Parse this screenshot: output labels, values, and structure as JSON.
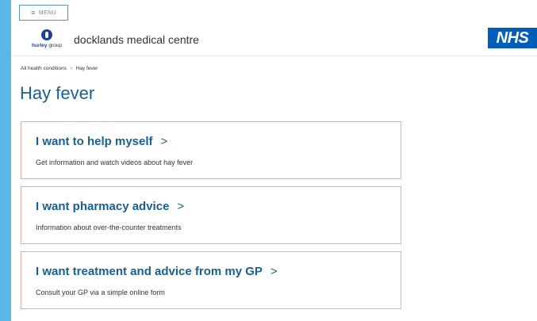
{
  "header": {
    "menu_label": "MENU",
    "logo_text_part1": "hurley",
    "logo_text_part2": "group",
    "practice_name": "docklands medical centre",
    "nhs_logo": "NHS"
  },
  "breadcrumb": {
    "parent": "All health conditions",
    "separator": ">",
    "current": "Hay fever"
  },
  "page_title": "Hay fever",
  "cards": [
    {
      "title": "I want to help myself",
      "chevron": ">",
      "description": "Get information and watch videos about hay fever"
    },
    {
      "title": "I want pharmacy advice",
      "chevron": ">",
      "description": "Information about over-the-counter treatments"
    },
    {
      "title": "I want treatment and advice from my GP",
      "chevron": ">",
      "description": "Consult your GP via a simple online form"
    }
  ],
  "colors": {
    "accent": "#1a5f8f",
    "nhs_blue": "#005eb8",
    "card_border": "#f5a6a6",
    "frame": "#5bb8e6"
  }
}
